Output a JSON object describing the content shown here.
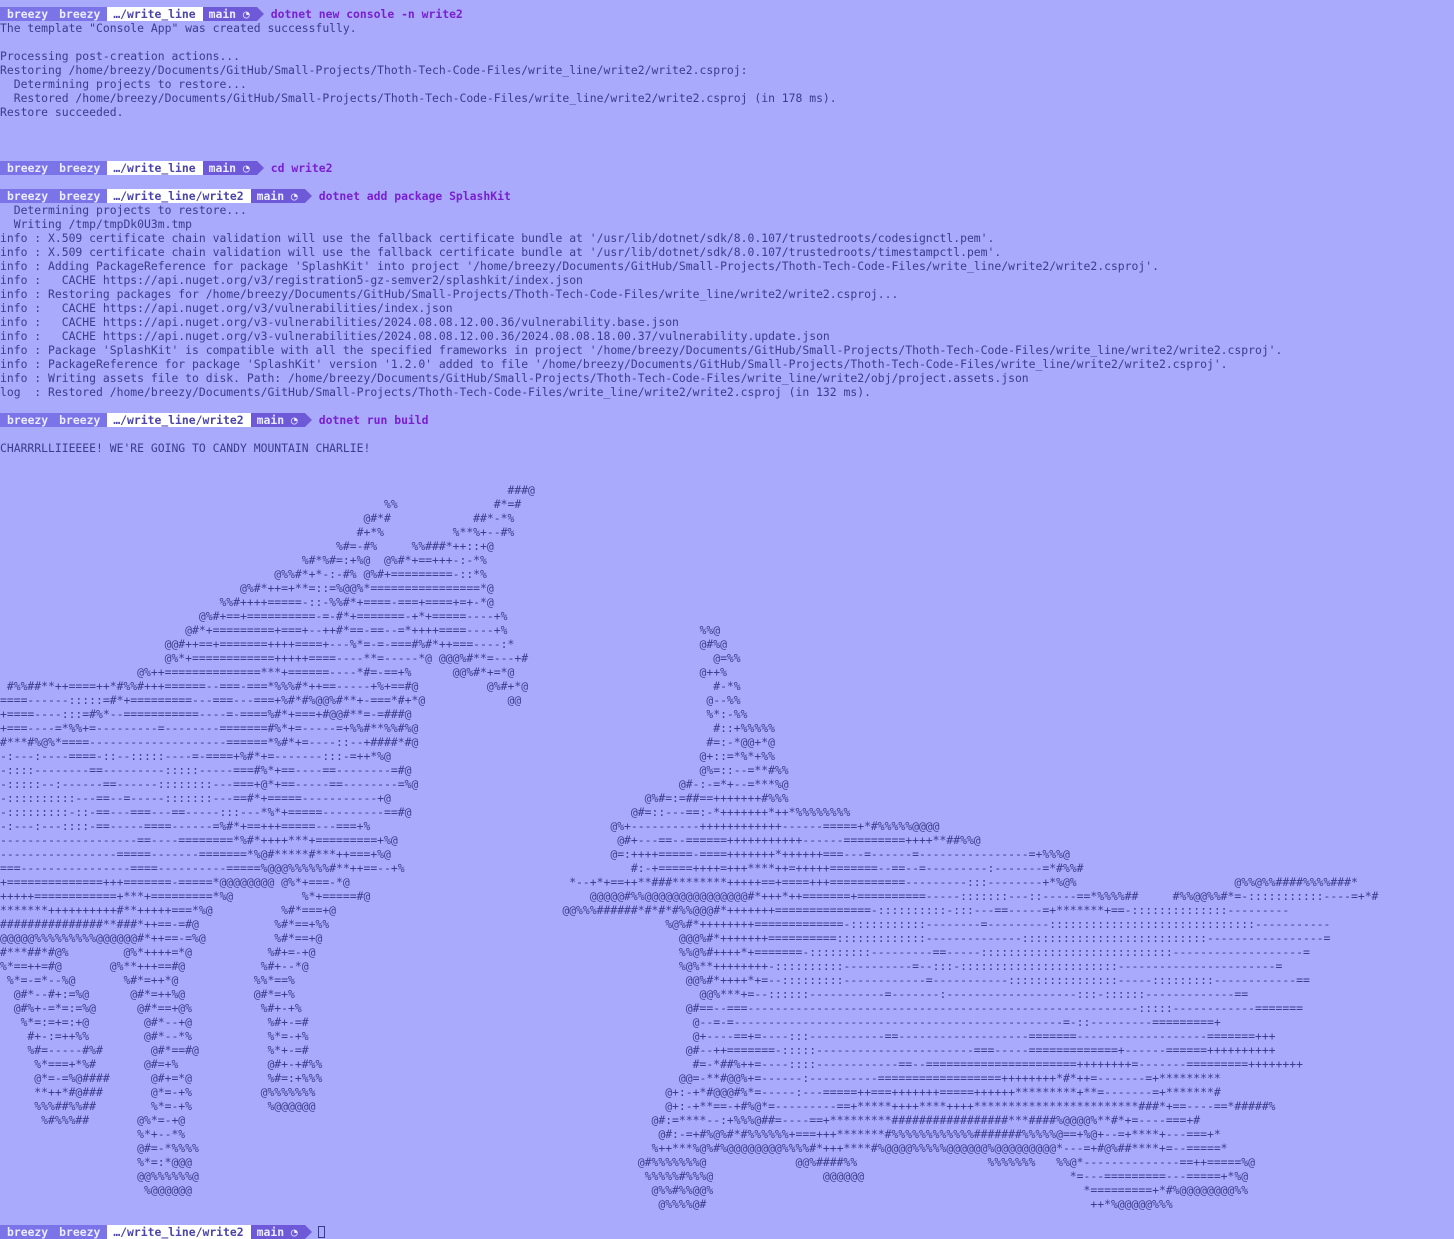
{
  "prompts": [
    {
      "user": "breezy",
      "host": "breezy",
      "dir": "…/write_line",
      "git": "main ◔",
      "command": "dotnet new console -n write2"
    },
    {
      "user": "breezy",
      "host": "breezy",
      "dir": "…/write_line",
      "git": "main ◔",
      "command": "cd write2"
    },
    {
      "user": "breezy",
      "host": "breezy",
      "dir": "…/write_line/write2",
      "git": "main ◔",
      "command": "dotnet add package SplashKit"
    },
    {
      "user": "breezy",
      "host": "breezy",
      "dir": "…/write_line/write2",
      "git": "main ◔",
      "command": "dotnet run build"
    },
    {
      "user": "breezy",
      "host": "breezy",
      "dir": "…/write_line/write2",
      "git": "main ◔",
      "command": ""
    }
  ],
  "output1": [
    "The template \"Console App\" was created successfully.",
    "",
    "Processing post-creation actions...",
    "Restoring /home/breezy/Documents/GitHub/Small-Projects/Thoth-Tech-Code-Files/write_line/write2/write2.csproj:",
    "  Determining projects to restore...",
    "  Restored /home/breezy/Documents/GitHub/Small-Projects/Thoth-Tech-Code-Files/write_line/write2/write2.csproj (in 178 ms).",
    "Restore succeeded."
  ],
  "output3": [
    "  Determining projects to restore...",
    "  Writing /tmp/tmpDk0U3m.tmp",
    "info : X.509 certificate chain validation will use the fallback certificate bundle at '/usr/lib/dotnet/sdk/8.0.107/trustedroots/codesignctl.pem'.",
    "info : X.509 certificate chain validation will use the fallback certificate bundle at '/usr/lib/dotnet/sdk/8.0.107/trustedroots/timestampctl.pem'.",
    "info : Adding PackageReference for package 'SplashKit' into project '/home/breezy/Documents/GitHub/Small-Projects/Thoth-Tech-Code-Files/write_line/write2/write2.csproj'.",
    "info :   CACHE https://api.nuget.org/v3/registration5-gz-semver2/splashkit/index.json",
    "info : Restoring packages for /home/breezy/Documents/GitHub/Small-Projects/Thoth-Tech-Code-Files/write_line/write2/write2.csproj...",
    "info :   CACHE https://api.nuget.org/v3/vulnerabilities/index.json",
    "info :   CACHE https://api.nuget.org/v3-vulnerabilities/2024.08.08.12.00.36/vulnerability.base.json",
    "info :   CACHE https://api.nuget.org/v3-vulnerabilities/2024.08.08.12.00.36/2024.08.08.18.00.37/vulnerability.update.json",
    "info : Package 'SplashKit' is compatible with all the specified frameworks in project '/home/breezy/Documents/GitHub/Small-Projects/Thoth-Tech-Code-Files/write_line/write2/write2.csproj'.",
    "info : PackageReference for package 'SplashKit' version '1.2.0' added to file '/home/breezy/Documents/GitHub/Small-Projects/Thoth-Tech-Code-Files/write_line/write2/write2.csproj'.",
    "info : Writing assets file to disk. Path: /home/breezy/Documents/GitHub/Small-Projects/Thoth-Tech-Code-Files/write_line/write2/obj/project.assets.json",
    "log  : Restored /home/breezy/Documents/GitHub/Small-Projects/Thoth-Tech-Code-Files/write_line/write2/write2.csproj (in 132 ms)."
  ],
  "output4_message": "CHARRRLLIIEEEE! WE'RE GOING TO CANDY MOUNTAIN CHARLIE!",
  "ascii_art": [
    "                                                                          ###@",
    "                                                        %%              #*=#",
    "                                                     @#*#            ##*-*%",
    "                                                    #+*%          %**%+--#%",
    "                                                 %#=-#%     %%###*++::+@",
    "                                            %#*%#=:+%@  @%#*+==+++-:-*%",
    "                                        @%%#*+*-:-#% @%#+=========-::*%",
    "                                   @%#*++=+**=::=%@@%*================*@",
    "                                %%#++++=====-::-%%#*+====-===+====+=+-*@",
    "                             @%#+==+==========-=-#*+=======-+*+=====----+%",
    "                           @#*+=========+===+--++#*==-==--=*++++====----+%                            %%@",
    "                        @@#++==+=======++++====+---%*=-=-===#%#*++===----:*                           @#%@",
    "                        @%*+============+++++====----**=-----*@ @@@%#**=---+#                           @=%%",
    "                    @%++==============***+======----*#=-==+%      @@%#*+=*@                           @++%",
    " #%%##**++====++*#%%#+++======--===-===*%%%#*++==-----+%+==#@          @%#+*@                           #-*%",
    "====------:::::=#*+=========---===---===+%#*#%@@%#**+-===*#+*@            @@                           @--%%",
    "+====----:::=#%*--===========----=-====%#*+===+#@@#**=-=###@                                           %*:-%%",
    "+===----=*%%+=---------=--------=======#%*+=-----=+%%#**%%#%@                                           #::+%%%%%",
    "#***#%@%*====--------------------======*%#*+=----::--+####*#@                                          #=:-*@@+*@",
    "-:---:----====-::--:::::----=-====+%#*+=-------:::-=++*%@                                             @+::=*%*+%%",
    "-::::--------==---------:::::-----===#%*+==----==--------=#@                                          @%=::--=**#%%",
    "-:::::--:------==------::::::::---===+@*+==-----==--------=%@                                      @#-:-=*+--=***%@",
    "-::::::::::---==--=-----:::::::---==#*+=====-----------+@                                     @%#=:=##==+++++++#%%%",
    "-:::::::::-::-==---===---==-----:::---*%*+=====---------==#@                                @#=::---==:-*+++++++*++*%%%%%%%%",
    "-:---:---::::-==-----====------=%#*+==+++=====---===+%                                   @%+----------++++++++++++------=====+*#%%%%%@@@@",
    "--------------------==----========*%#*++++***+=========+%@                                @#+---==--======+++++++++++------=========++++**##%%@",
    "-----------------=====-------=======*%@#*****#***++===+%@                                @=:++++=====-====+++++++*++++++===---=------=----------------=+%%%@",
    "===----------------====----------=====%@@@%%%%%%#**++==--+%                                 #:-+=====++++=+++****++=+++++=======--==--=---------:-------=*#%%#",
    "+==============+++=======-=====*@@@@@@@@ @%*+===-*@                                *--+*+==++**###********+++++==+====+++===========---------:::--------+*%@%                       @%%@%%####%%%%###*",
    "+++++============+***+=========*%@          %*+=====#@                                @@@@@#%%@@@@@@@@@@@@@@@#*+++*++=======+==========-----:::::::---::-----==*%%%%##     #%%@@%%#*=-:::::::::::----=+*#",
    "*******++++++++++#**+++++===*%@          %#*===+@                                 @@%%%######*#*#*#%%@@@#*+++++++==============-::::::::::-:::---==-----=+*******+==-::::::::::::::---------",
    "###############**###*++==-=#@           %#*==+%%                                                 %@%#*++++++++=============-:::::::::::--------=---------::::::::::::::::::::::::::::::-----------",
    "@@@@@%%%%%%%%%@@@@@@#*++==-=%@          %#*==+@                                                    @@@%#*+++++++==========:::::::::::::--------------:::::::::::::::::::::::::::-----------------=",
    "#***##*#@%        @%*++++=*@           %#+=-+@                                                     %%@%#++++*+=======-:::::::::---------==-----::::::::::::::::::::::::::::-------------------=",
    "%*==++=#@       @%**+++==#@           %#+--*@                                                      %@%**++++++++-::::::::::----------=--:::-:::::::::::::::::::::::-----------------------=",
    " %*=-=*--%@       %#*=++*@           %%*==%                                                         @@%#*++++*+=--:::::::::------------=-----------::::::::::::::::-----:::::::::------------==",
    "  @#*--#+:=%@      @#*=++%@          @#*=+%                                                           @@%***+=--::::::-----------=-------:-------------------:::-::::::-------------==",
    "  @#%+-=*=:=%@      @#*==+@%          %#+-+%                                                        @#==--===---------------------------------------------------------:::::------------=======",
    "   %*=:=+=:+@        @#*--+@           %#+-=#                                                        @--=-=------------------------------------------------=-::---------=========+",
    "    #+-:=++%%        @#*--*%           %*=-+%                                                        @+----==+=----:::-----------==-------------------=======-------------------=======+++",
    "    %#=-----#%#       @#*==#@          %*+-=#                                                       @#--++=======-:::::-----------------------===-----=============+------======++++++++++",
    "     %*===+*%#       @#=+%             @#+-+#%%                                                      #=-*##%++=----::::------------==--======================++++++++=-------=========++++++++",
    "     @*=-=%@####      @#+=*@           %#=:+%%%                                                    @@=-**#@@%+=------:----------==================++++++++*#*++=-------=+*********",
    "     **++*#@###       @*=-+%          @%%%%%%%                                                   @+:-+*#@@@#%*=-----:---=====++===+++++++=====++++++*********+**=-------=+*******#",
    "     %%%##%%##        %*=-+%           %@@@@@@                                                   @+:-+**==-+#%@*=---------==+*****++++****++++************************###*+==----==*#####%",
    "      %#%%%##       @%*=-+@                                                                    @#:=****--:+%%%@##=----==+*********#################***####%@@@@%**#*+=----===+#",
    "                    %*+--*%                                                                     @#:-=+#%@%#*#%%%%%%+===+++*******#%%%%%%%%%%%%#######%%%%%@==+%@+--=+****+---===+*",
    "                    @#=-*%%%%                                                                  %++***%@%#%@@@@@@@@%%%%#*+++****#%@@@@%%%%%@@@@@@%@@@@@@@@@*---=+#@%##****+=--=====*",
    "                    %*=:*@@@                                                                 @#%%%%%%%@             @@%####%%                   %%%%%%%   %%@*--------------==++=====%@",
    "                    @@%%%%%%@                                                                 %%%%%#%%%@                @@@@@@                              *=---=========---=====+*%@",
    "                     %@@@@@@                                                                   @%%#%%@@%                                                      *=========+*#%@@@@@@@@%%",
    "                                                                                                @%%%%@#                                                        ++*%@@@@@%%%"
  ]
}
